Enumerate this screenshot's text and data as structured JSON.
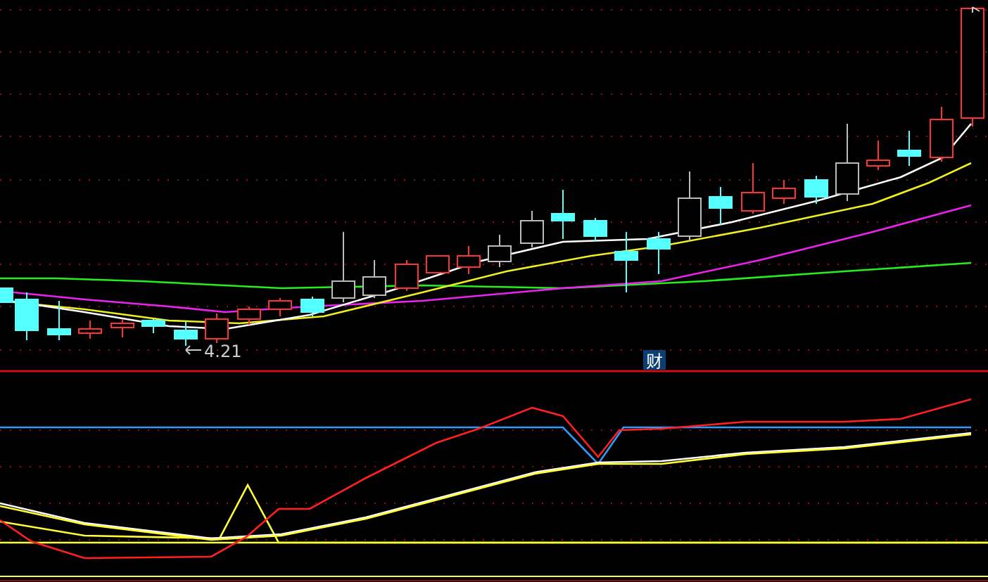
{
  "price_panel": {
    "low_label": "4.21",
    "event_marker": "财"
  }
}
